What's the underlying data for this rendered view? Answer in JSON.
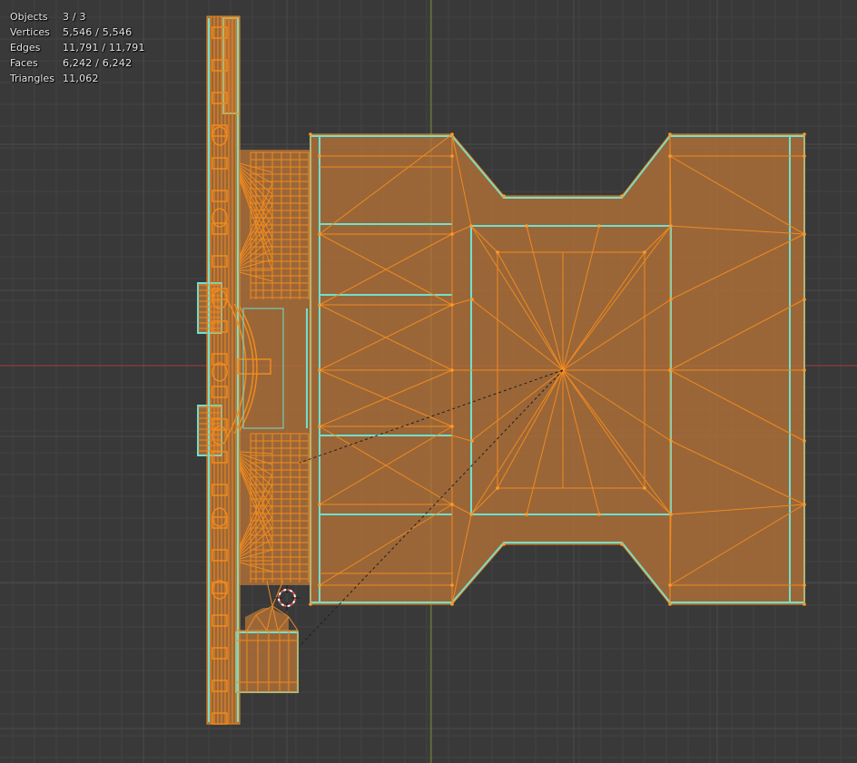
{
  "stats": {
    "objects": {
      "label": "Objects",
      "value": "3 / 3"
    },
    "vertices": {
      "label": "Vertices",
      "value": "5,546 / 5,546"
    },
    "edges": {
      "label": "Edges",
      "value": "11,791 / 11,791"
    },
    "faces": {
      "label": "Faces",
      "value": "6,242 / 6,242"
    },
    "triangles": {
      "label": "Triangles",
      "value": "11,062"
    }
  },
  "colors": {
    "background": "#393939",
    "grid_minor": "#414141",
    "grid_major": "#484848",
    "x_axis": "#a63a3a",
    "y_axis": "#6f8f2e",
    "face_fill": "#a06a3a",
    "wire_orange": "#f08a1e",
    "wire_cyan": "#6fe0d0",
    "cursor_red": "#e05050"
  },
  "icons": {
    "cursor": "3d-cursor-icon"
  }
}
